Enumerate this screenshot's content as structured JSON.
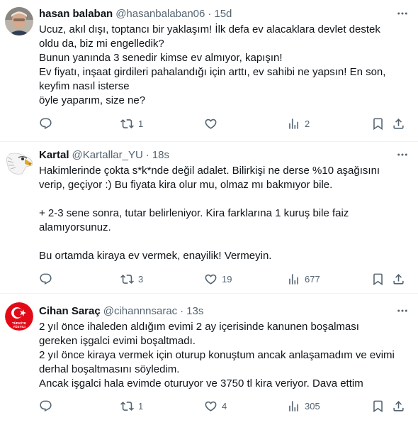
{
  "tweets": [
    {
      "name": "hasan balaban",
      "handle": "@hasanbalaban06",
      "sep": "·",
      "time": "15d",
      "avatar": "person-photo",
      "lines": [
        "Ucuz, akıl dışı, toptancı bir yaklaşım! İlk defa ev alacaklara devlet destek",
        "oldu da, biz mi engelledik?",
        "Bunun yanında 3 senedir kimse ev almıyor, kapışın!",
        "Ev fiyatı, inşaat girdileri pahalandığı için arttı, ev sahibi ne yapsın! En son,",
        "keyfim nasıl isterse",
        "öyle yaparım, size ne?"
      ],
      "stats": {
        "replies": "",
        "retweets": "1",
        "likes": "",
        "views": "2"
      }
    },
    {
      "name": "Kartal",
      "handle": "@Kartallar_YU",
      "sep": "·",
      "time": "18s",
      "avatar": "eagle-head",
      "lines": [
        "Hakimlerinde çokta s*k*nde değil adalet. Bilirkişi ne derse %10 aşağısını",
        "verip, geçiyor :) Bu fiyata kira olur mu, olmaz mı bakmıyor bile.",
        "",
        "+ 2-3 sene sonra, tutar belirleniyor. Kira farklarına 1 kuruş bile faiz",
        "alamıyorsunuz.",
        "",
        "Bu ortamda kiraya ev vermek, enayilik! Vermeyin."
      ],
      "stats": {
        "replies": "",
        "retweets": "3",
        "likes": "19",
        "views": "677"
      }
    },
    {
      "name": "Cihan Saraç",
      "handle": "@cihannnsarac",
      "sep": "·",
      "time": "13s",
      "avatar": "turkiye-flag-badge",
      "avatar_caption": "TÜRKİYE YÜZYILI",
      "lines": [
        "2 yıl önce ihaleden aldığım evimi 2 ay içerisinde kanunen boşalması",
        "gereken işgalci evimi boşaltmadı.",
        "2 yıl önce kiraya vermek için oturup konuştum ancak anlaşamadım ve evimi",
        "derhal boşaltmasını söyledim.",
        "Ancak işgalci hala evimde oturuyor ve 3750 tl kira veriyor. Dava ettim"
      ],
      "stats": {
        "replies": "",
        "retweets": "1",
        "likes": "4",
        "views": "305"
      }
    }
  ],
  "icons": {
    "reply": "reply-icon",
    "retweet": "retweet-icon",
    "like": "heart-icon",
    "views": "views-icon",
    "bookmark": "bookmark-icon",
    "share": "share-icon",
    "more": "more-icon"
  },
  "colors": {
    "text": "#0f1419",
    "muted": "#536471",
    "divider": "#eff3f4",
    "flag_red": "#e30a17"
  }
}
